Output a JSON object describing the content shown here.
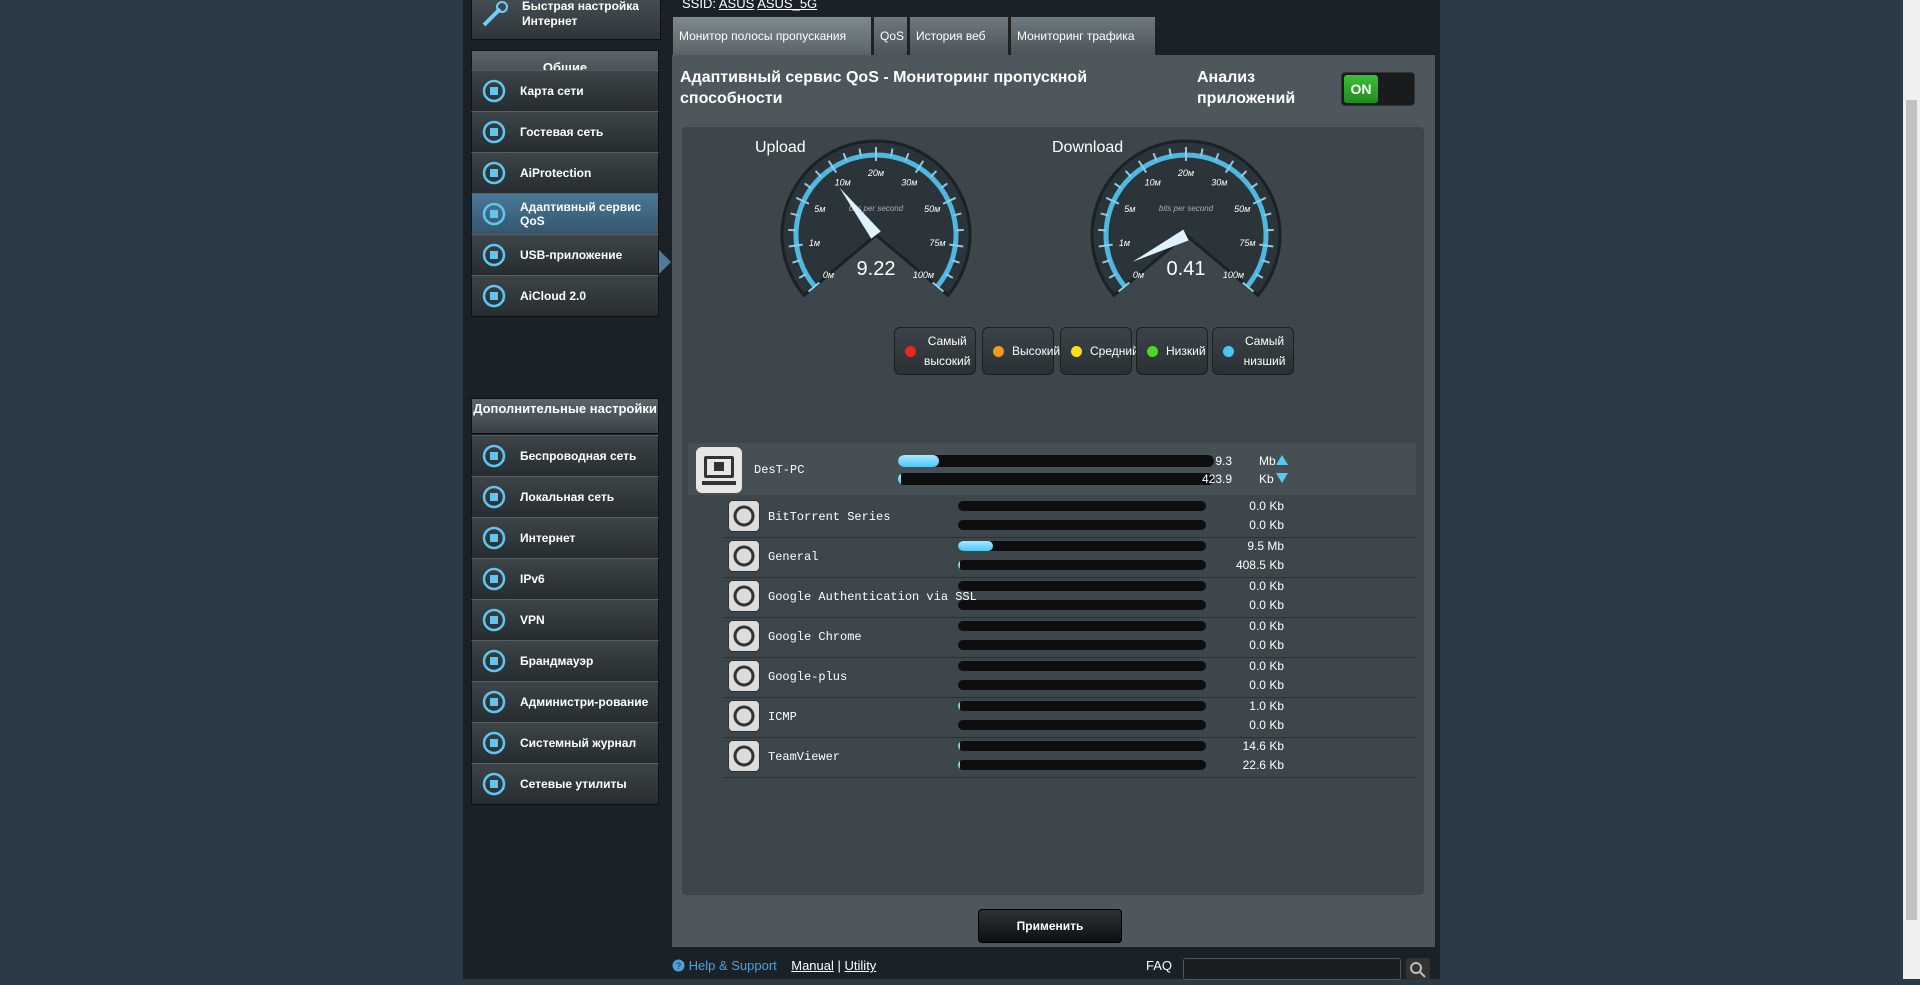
{
  "sidebar": {
    "quick_setup": "Быстрая настройка Интернет",
    "general_header": "Общие",
    "general_items": [
      {
        "label": "Карта сети",
        "icon": "network-map-icon"
      },
      {
        "label": "Гостевая сеть",
        "icon": "guest-network-icon"
      },
      {
        "label": "AiProtection",
        "icon": "lock-icon"
      },
      {
        "label": "Адаптивный сервис QoS",
        "icon": "qos-chart-icon",
        "active": true
      },
      {
        "label": "USB-приложение",
        "icon": "puzzle-icon"
      },
      {
        "label": "AiCloud 2.0",
        "icon": "cloud-icon"
      }
    ],
    "advanced_header": "Дополнительные настройки",
    "advanced_items": [
      {
        "label": "Беспроводная сеть",
        "icon": "wifi-icon"
      },
      {
        "label": "Локальная сеть",
        "icon": "home-icon"
      },
      {
        "label": "Интернет",
        "icon": "globe-icon"
      },
      {
        "label": "IPv6",
        "icon": "ipv6-icon"
      },
      {
        "label": "VPN",
        "icon": "vpn-icon"
      },
      {
        "label": "Брандмауэр",
        "icon": "shield-icon"
      },
      {
        "label": "Администри-рование",
        "icon": "admin-user-icon"
      },
      {
        "label": "Системный журнал",
        "icon": "log-icon"
      },
      {
        "label": "Сетевые утилиты",
        "icon": "tools-icon"
      }
    ]
  },
  "ssid": {
    "label": "SSID:",
    "n1": "ASUS",
    "n2": "ASUS_5G"
  },
  "tabs": [
    "Монитор полосы пропускания",
    "QoS",
    "История веб",
    "Мониторинг трафика"
  ],
  "header": {
    "title": "Адаптивный сервис QoS - Мониторинг пропускной способности",
    "analysis": "Анализ приложений",
    "toggle": "ON"
  },
  "gauges": {
    "upload": {
      "label": "Upload",
      "value": "9.22",
      "level": 9.22
    },
    "download": {
      "label": "Download",
      "value": "0.41",
      "level": 0.41
    },
    "caption": "bits per second",
    "ticks": [
      "0м",
      "1м",
      "5м",
      "10м",
      "20м",
      "30м",
      "50м",
      "75м",
      "100м"
    ]
  },
  "legend": [
    {
      "label": "Самый высокий",
      "color": "#e8281e"
    },
    {
      "label": "Высокий",
      "color": "#f39a1e"
    },
    {
      "label": "Средний",
      "color": "#f6e11c"
    },
    {
      "label": "Низкий",
      "color": "#4fd62a"
    },
    {
      "label": "Самый низший",
      "color": "#4cc5f2"
    }
  ],
  "device": {
    "name": "DesT-PC",
    "up_val": "9.3",
    "up_unit": "Mb",
    "up_fill": 0.13,
    "down_val": "423.9",
    "down_unit": "Kb",
    "down_fill": 0.01
  },
  "apps": [
    {
      "name": "BitTorrent Series",
      "icon": "bittorrent-icon",
      "up": "0.0 Kb",
      "down": "0.0 Kb",
      "up_fill": 0,
      "down_fill": 0
    },
    {
      "name": "General",
      "icon": "general-app-icon",
      "up": "9.5 Mb",
      "down": "408.5 Kb",
      "up_fill": 0.14,
      "down_fill": 0.01
    },
    {
      "name": "Google Authentication via SSL",
      "icon": "ssl-auth-icon",
      "up": "0.0 Kb",
      "down": "0.0 Kb",
      "up_fill": 0,
      "down_fill": 0
    },
    {
      "name": "Google Chrome",
      "icon": "chrome-icon",
      "up": "0.0 Kb",
      "down": "0.0 Kb",
      "up_fill": 0,
      "down_fill": 0
    },
    {
      "name": "Google-plus",
      "icon": "google-plus-icon",
      "up": "0.0 Kb",
      "down": "0.0 Kb",
      "up_fill": 0,
      "down_fill": 0
    },
    {
      "name": "ICMP",
      "icon": "icmp-icon",
      "up": "1.0 Kb",
      "down": "0.0 Kb",
      "up_fill": 0.005,
      "down_fill": 0
    },
    {
      "name": "TeamViewer",
      "icon": "teamviewer-icon",
      "up": "14.6 Kb",
      "down": "22.6 Kb",
      "up_fill": 0.005,
      "down_fill": 0.005
    }
  ],
  "apply": "Применить",
  "footer": {
    "help": "Help & Support",
    "manual": "Manual",
    "sep": "|",
    "utility": "Utility",
    "faq": "FAQ"
  }
}
